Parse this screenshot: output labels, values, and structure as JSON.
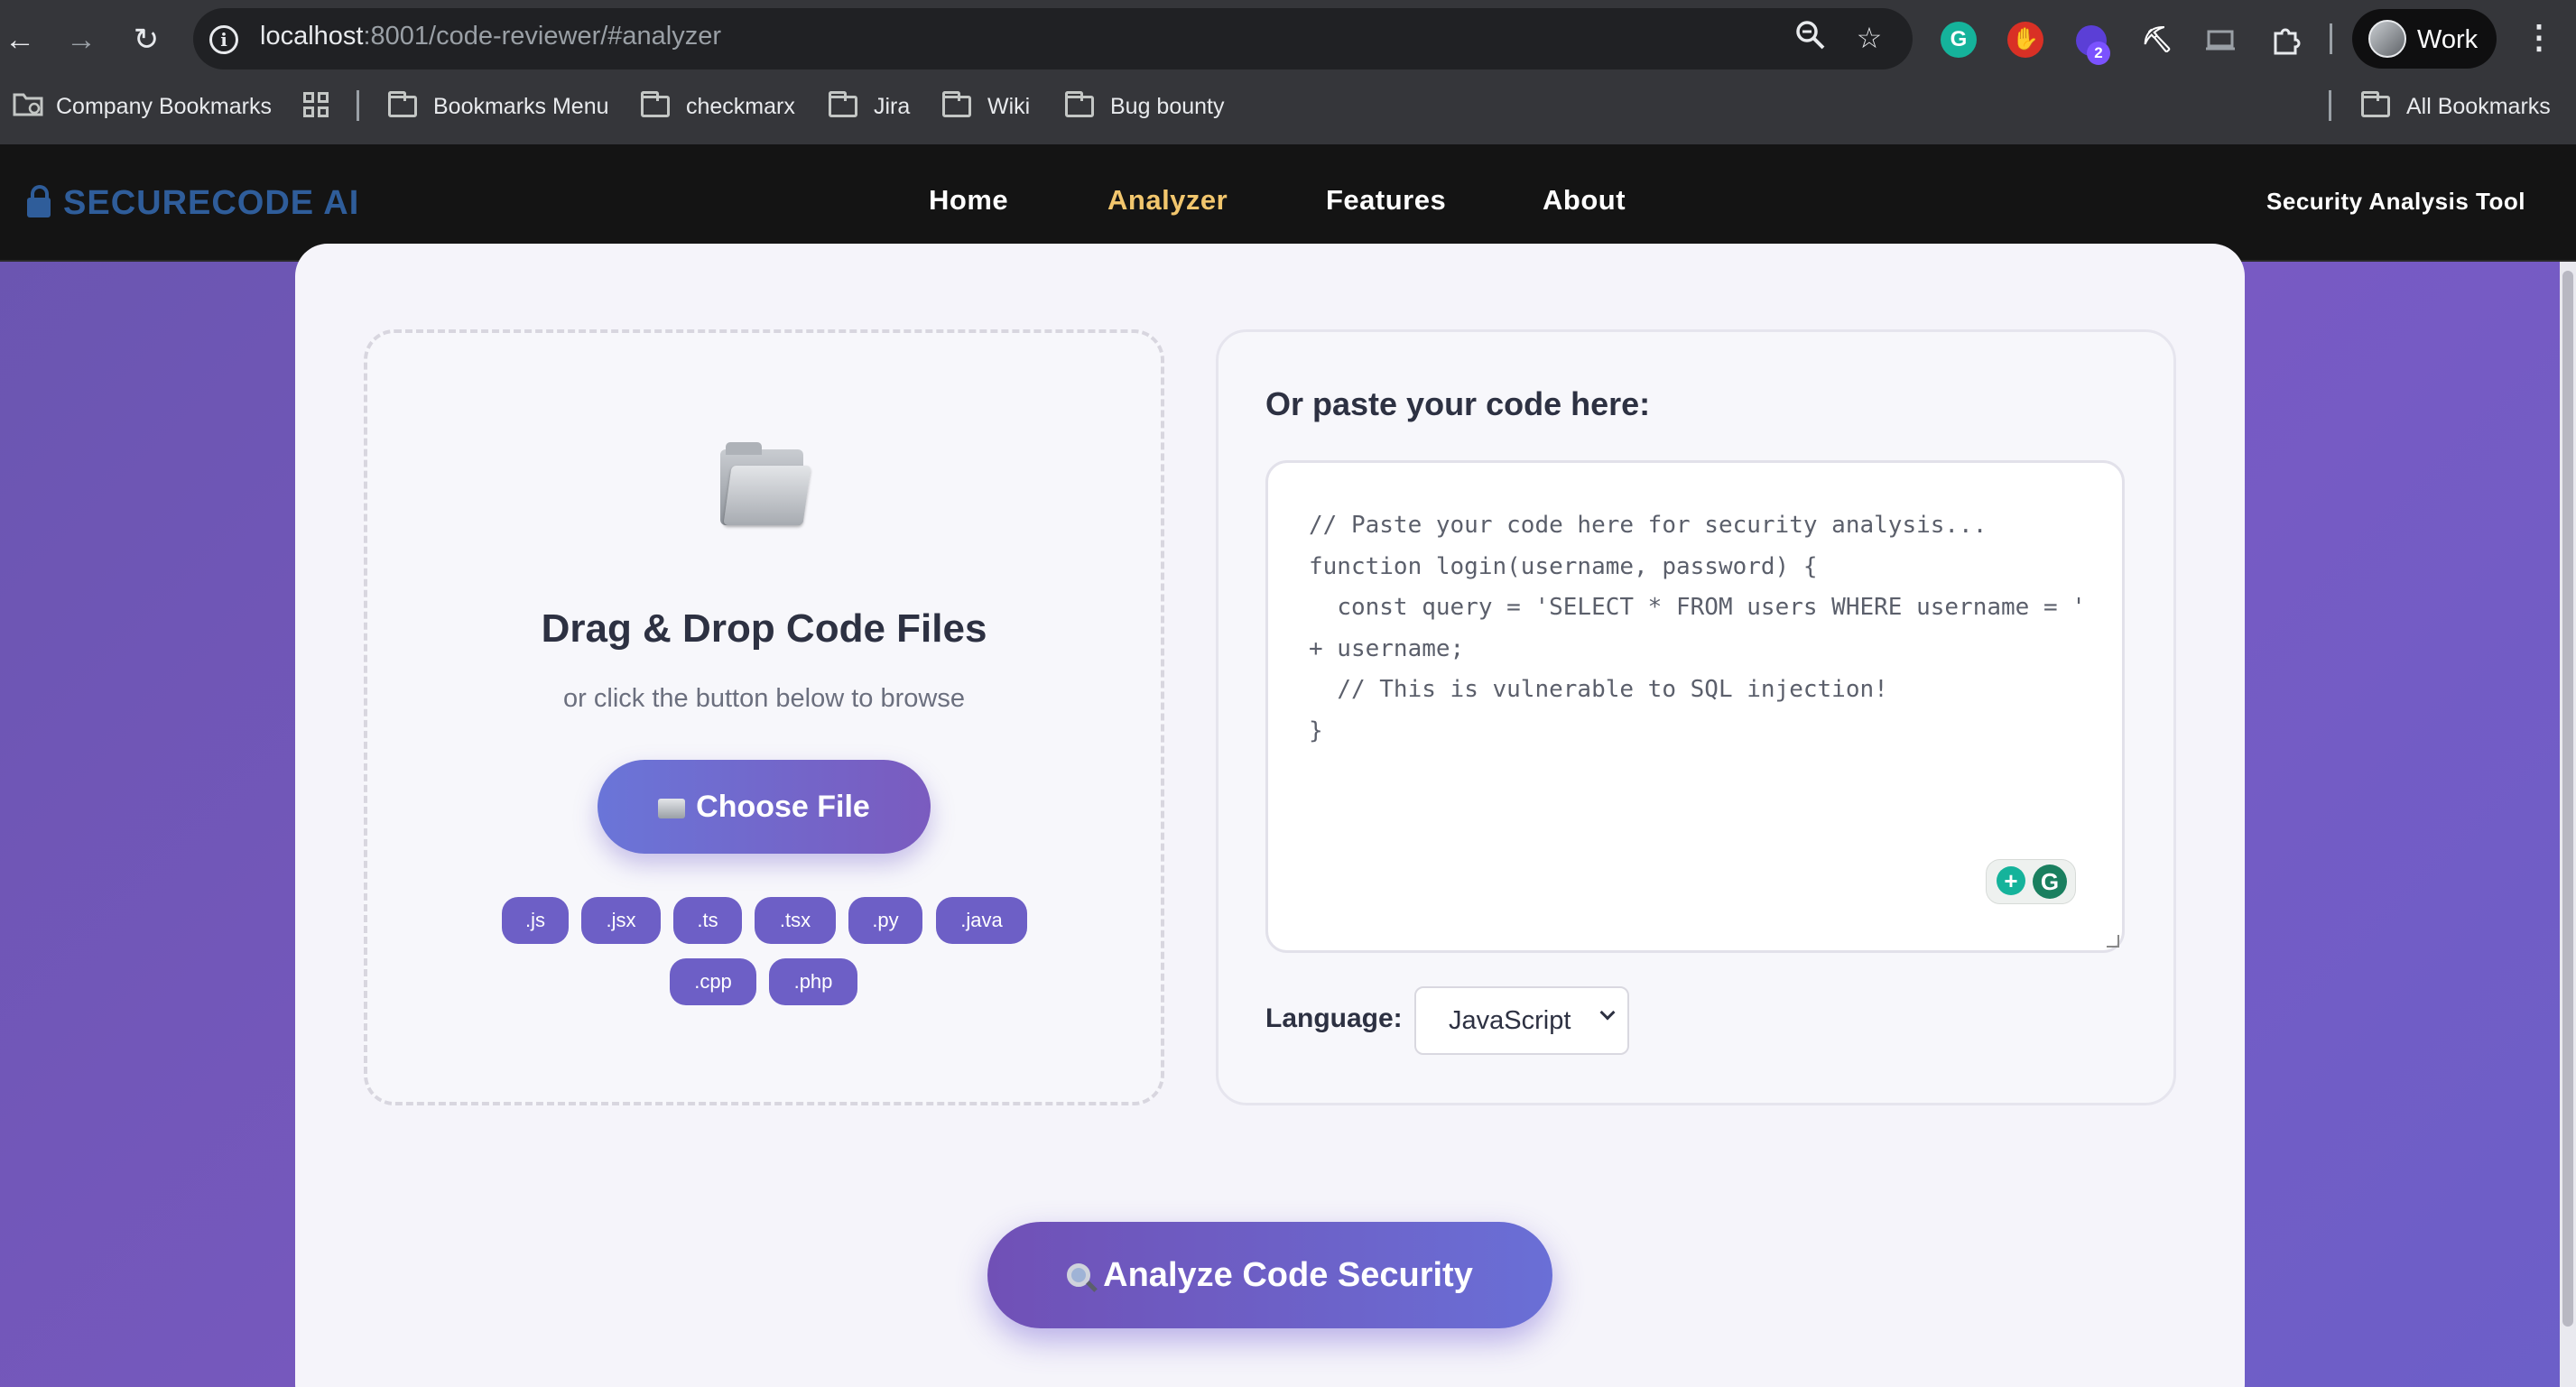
{
  "browser": {
    "url_host": "localhost",
    "url_path": ":8001/code-reviewer/#analyzer",
    "profile_label": "Work",
    "extension_badge": "2",
    "bookmarks": [
      {
        "label": "Company Bookmarks",
        "icon": "managed-bookmarks-icon"
      },
      {
        "label": "Bookmarks Menu",
        "icon": "folder-icon"
      },
      {
        "label": "checkmarx",
        "icon": "folder-icon"
      },
      {
        "label": "Jira",
        "icon": "folder-icon"
      },
      {
        "label": "Wiki",
        "icon": "folder-icon"
      },
      {
        "label": "Bug bounty",
        "icon": "folder-icon"
      }
    ],
    "all_bookmarks": "All Bookmarks"
  },
  "site": {
    "logo": "SECURECODE AI",
    "nav": [
      "Home",
      "Analyzer",
      "Features",
      "About"
    ],
    "active_nav": "Analyzer",
    "tagline": "Security Analysis Tool",
    "accent": "#f2c66d"
  },
  "upload": {
    "title": "Drag & Drop Code Files",
    "subtitle": "or click the button below to browse",
    "button": "Choose File",
    "extensions": [
      ".js",
      ".jsx",
      ".ts",
      ".tsx",
      ".py",
      ".java",
      ".cpp",
      ".php"
    ]
  },
  "paste": {
    "title": "Or paste your code here:",
    "code": "// Paste your code here for security analysis...\nfunction login(username, password) {\n  const query = 'SELECT * FROM users WHERE username = ' + username;\n  // This is vulnerable to SQL injection!\n}",
    "language_label": "Language:",
    "language_value": "JavaScript"
  },
  "action": {
    "analyze_button": "Analyze Code Security"
  }
}
